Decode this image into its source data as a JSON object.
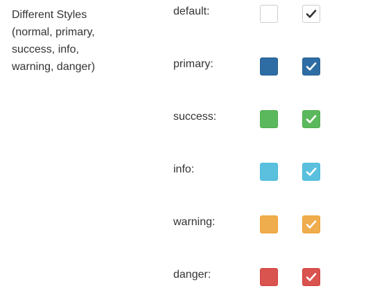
{
  "description": {
    "lines": [
      "Different Styles",
      "(normal, primary,",
      "success, info,",
      "warning, danger)"
    ]
  },
  "rows": [
    {
      "label": "default:",
      "style": "default",
      "bg": "#ffffff",
      "border": "#cccccc",
      "check_color": "#333333",
      "unchecked": false,
      "checked": true
    },
    {
      "label": "primary:",
      "style": "primary",
      "bg": "#2e6da4",
      "border": "#285e8e",
      "check_color": "#ffffff",
      "unchecked": false,
      "checked": true
    },
    {
      "label": "success:",
      "style": "success",
      "bg": "#5cb85c",
      "border": "#4cae4c",
      "check_color": "#ffffff",
      "unchecked": false,
      "checked": true
    },
    {
      "label": "info:",
      "style": "info",
      "bg": "#5bc0de",
      "border": "#46b8da",
      "check_color": "#ffffff",
      "unchecked": false,
      "checked": true
    },
    {
      "label": "warning:",
      "style": "warning",
      "bg": "#f0ad4e",
      "border": "#eea236",
      "check_color": "#ffffff",
      "unchecked": false,
      "checked": true
    },
    {
      "label": "danger:",
      "style": "danger",
      "bg": "#d9534f",
      "border": "#d43f3a",
      "check_color": "#ffffff",
      "unchecked": false,
      "checked": true
    }
  ],
  "icons": {
    "check": "check-icon"
  }
}
